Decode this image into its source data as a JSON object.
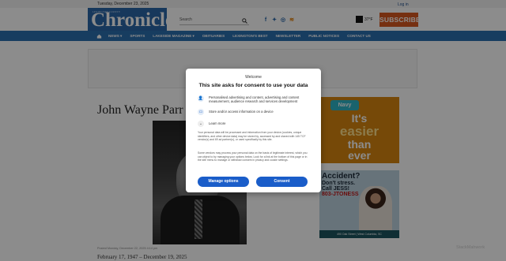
{
  "header": {
    "date": "Tuesday, December 23, 2025",
    "login": "Log in",
    "masthead_small": "LEXINGTON COUNTY",
    "masthead_big": "Chronicle",
    "search_label": "Search",
    "weather_temp": "37°F",
    "subscribe": "SUBSCRIBE"
  },
  "nav": {
    "items": [
      "NEWS ▾",
      "SPORTS",
      "LAKESIDE MAGAZINE ▾",
      "OBITUARIES",
      "LEXINGTON'S BEST",
      "NEWSLETTER",
      "PUBLIC NOTICES",
      "CONTACT US"
    ]
  },
  "article": {
    "title": "John Wayne Parr",
    "posted": "Posted Monday, December 22, 2025 4:14 pm",
    "dates": "February 17, 1947 – December 19, 2025"
  },
  "ads": {
    "teal_logo": "Navy",
    "teal_lines": [
      "It's",
      "easier",
      "than",
      "ever"
    ],
    "law_headline": "Accident?",
    "law_lines": [
      "Don't stress.",
      "Call JESS!",
      "803-JTONESS"
    ],
    "law_address": "490 Oak Street | West Columbia, SC"
  },
  "watermark": "StackMahwork",
  "consent": {
    "welcome": "Welcome",
    "title": "This site asks for consent to use your data",
    "purposes": [
      "Personalised advertising and content, advertising and content measurement, audience research and services development",
      "Store and/or access information on a device"
    ],
    "learn_more": "Learn more",
    "paragraph1": "Your personal data will be processed and information from your device (cookies, unique identifiers, and other device data) may be stored by, accessed by and shared with 145 TCF vendor(s) and 69 ad partner(s), or used specifically by this site.",
    "paragraph2": "Some vendors may process your personal data on the basis of legitimate interest, which you can object to by managing your options below. Look for a link at the bottom of this page or in the site menu to manage or withdraw consent in privacy and cookie settings.",
    "manage_button": "Manage options",
    "consent_button": "Consent"
  },
  "colors": {
    "nav_blue": "#2a6fb0",
    "subscribe_orange": "#d8581f",
    "consent_blue": "#1a5dc9"
  }
}
